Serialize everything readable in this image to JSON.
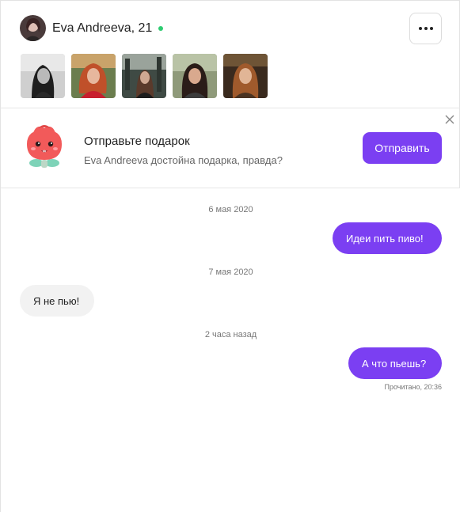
{
  "profile": {
    "name_age": "Eva Andreeva, 21",
    "online_color": "#2ecc71",
    "photos": [
      "photo-1",
      "photo-2",
      "photo-3",
      "photo-4",
      "photo-5"
    ]
  },
  "header": {
    "more_icon": "more-horizontal-icon"
  },
  "gift_banner": {
    "title": "Отправьте подарок",
    "subtitle": "Eva Andreeva достойна подарка, правда?",
    "button_label": "Отправить",
    "accent": "#7b3ff2"
  },
  "chat": {
    "messages": [
      {
        "date": "6 мая 2020",
        "direction": "out",
        "text": "Идеи пить пиво!"
      },
      {
        "date": "7 мая 2020",
        "direction": "in",
        "text": "Я не пью!"
      },
      {
        "date": "2 часа назад",
        "direction": "out",
        "text": "А что пьешь?"
      }
    ],
    "read_status": "Прочитано, 20:36"
  }
}
